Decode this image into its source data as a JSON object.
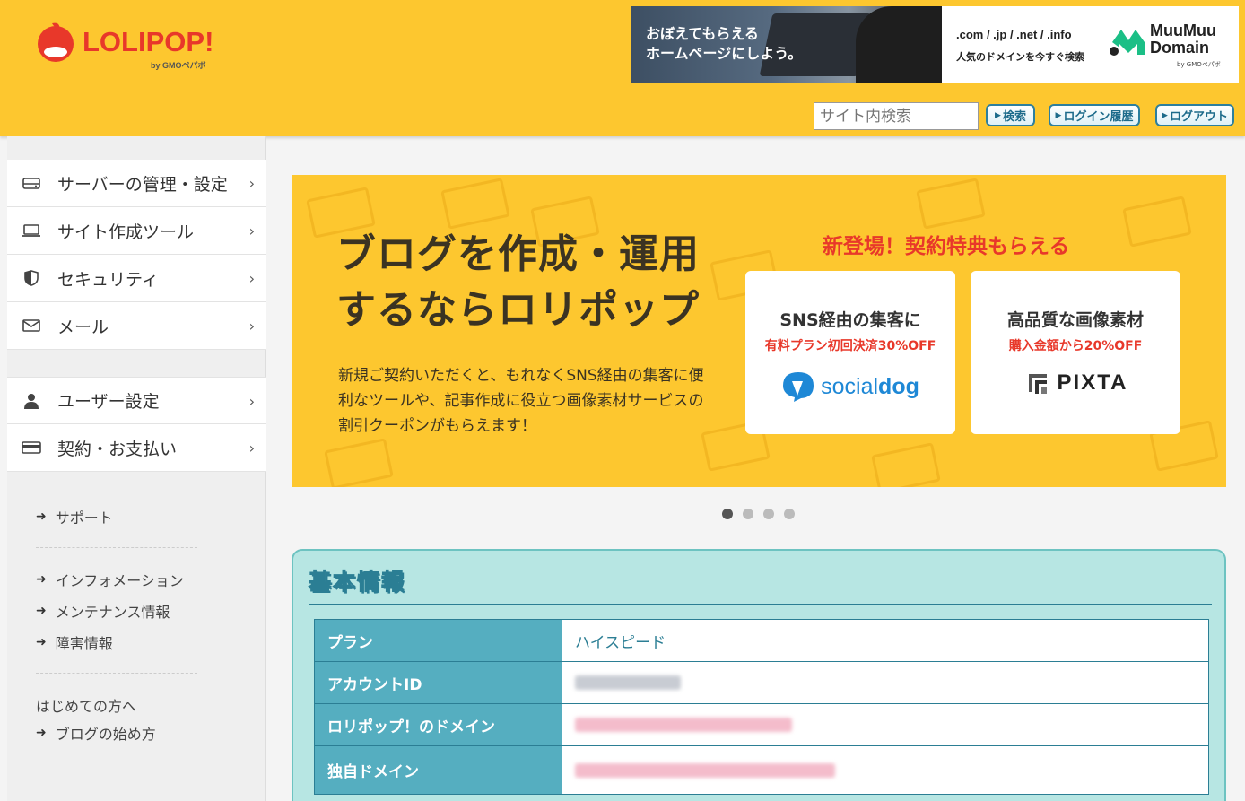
{
  "header": {
    "brand": "LOLIPOP!",
    "brand_sub": "by GMOペパボ",
    "ad_left_copy_1": "おぼえてもらえる",
    "ad_left_copy_2": "ホームページにしよう。",
    "ad_right_domains": ".com / .jp / .net / .info",
    "ad_right_sub": "人気のドメインを今すぐ検索",
    "ad_right_brand_1": "MuuMuu",
    "ad_right_brand_2": "Domain",
    "ad_right_by": "by GMOペパボ"
  },
  "toolbar": {
    "search_placeholder": "サイト内検索",
    "search_button": "検索",
    "login_history_button": "ログイン履歴",
    "logout_button": "ログアウト"
  },
  "sidebar": {
    "primary_items": [
      {
        "label": "サーバーの管理・設定",
        "icon": "server-icon"
      },
      {
        "label": "サイト作成ツール",
        "icon": "laptop-icon"
      },
      {
        "label": "セキュリティ",
        "icon": "shield-icon"
      },
      {
        "label": "メール",
        "icon": "mail-icon"
      }
    ],
    "secondary_items": [
      {
        "label": "ユーザー設定",
        "icon": "user-icon"
      },
      {
        "label": "契約・お支払い",
        "icon": "card-icon"
      }
    ],
    "support_link": "サポート",
    "info_links": [
      "インフォメーション",
      "メンテナンス情報",
      "障害情報"
    ],
    "beginner_label": "はじめての方へ",
    "beginner_link": "ブログの始め方"
  },
  "banner": {
    "title_line1": "ブログを作成・運用",
    "title_line2": "するならロリポップ",
    "desc": "新規ご契約いただくと、もれなくSNS経由の集客に便利なツールや、記事作成に役立つ画像素材サービスの割引クーポンがもらえます！",
    "cta": "新登場！契約特典もらえる",
    "cards": [
      {
        "title": "SNS経由の集客に",
        "sub": "有料プラン初回決済30%OFF",
        "brand_light": "social",
        "brand_bold": "dog"
      },
      {
        "title": "高品質な画像素材",
        "sub": "購入金額から20%OFF",
        "brand": "PIXTA"
      }
    ],
    "slide_count": 4,
    "active_slide": 1
  },
  "info": {
    "title": "基本情報",
    "rows": [
      {
        "label": "プラン",
        "value": "ハイスピード"
      },
      {
        "label": "アカウントID",
        "value": ""
      },
      {
        "label": "ロリポップ！のドメイン",
        "value": ""
      },
      {
        "label": "独自ドメイン",
        "value": ""
      }
    ]
  }
}
